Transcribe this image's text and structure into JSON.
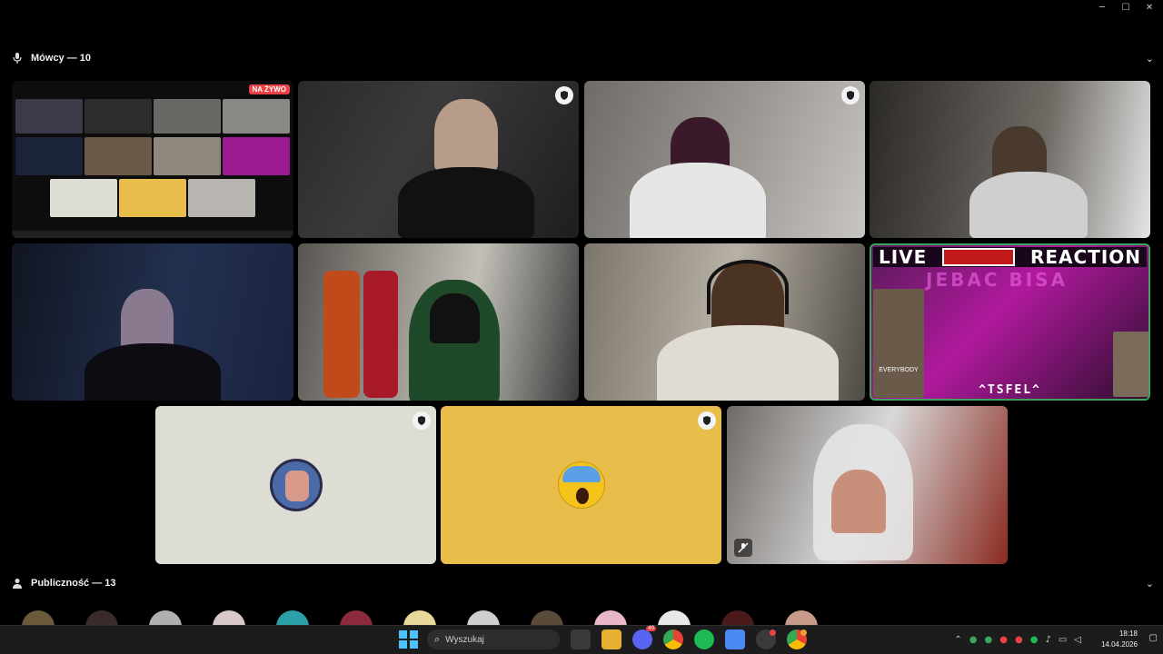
{
  "window": {
    "controls": {
      "minimize": "─",
      "maximize": "☐",
      "close": "✕"
    }
  },
  "speakers": {
    "title": "Mówcy — 10",
    "chevron": "⌄"
  },
  "screen_share": {
    "badge": "NA ŻYWO"
  },
  "reaction_stream": {
    "left": "LIVE",
    "right": "REACTION",
    "ticker": "JEBAC BISA",
    "tag": "^TSFEL^",
    "side_text": "EVERYBODY"
  },
  "audience": {
    "title": "Publiczność — 13",
    "chevron": "⌄"
  },
  "taskbar": {
    "search_placeholder": "Wyszukaj",
    "discord_badge": "40",
    "time": "18:18",
    "date": "14.04.2026"
  },
  "colors": {
    "live_red": "#ed4245",
    "avatar_beige": "#deddd4",
    "avatar_yellow": "#e8bd4a",
    "windows_blue": "#4cc2ff"
  }
}
